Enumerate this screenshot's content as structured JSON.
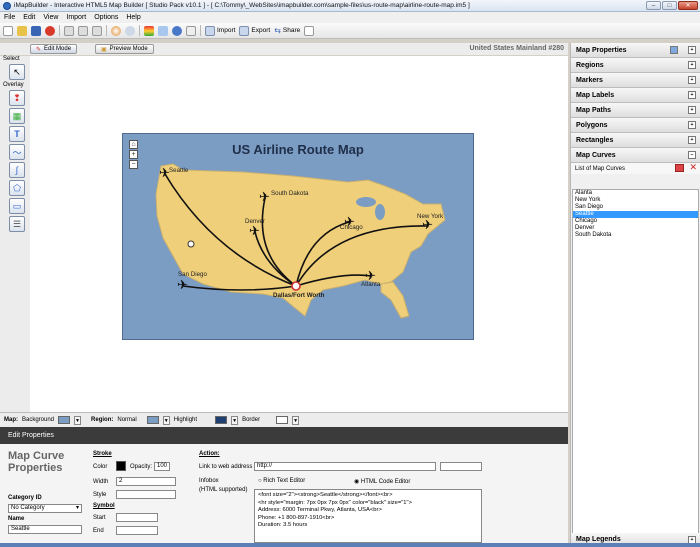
{
  "window": {
    "title": "iMapBuilder - Interactive HTML5 Map Builder [ Studio Pack v10.1 ] - [ C:\\Tommy\\_WebSites\\imapbuilder.com\\sample-files\\us-route-map\\airline-route-map.im5 ]",
    "min": "–",
    "max": "□",
    "close": "✕"
  },
  "menu": [
    "File",
    "Edit",
    "View",
    "Import",
    "Options",
    "Help"
  ],
  "toolbar": {
    "import": "Import",
    "export": "Export",
    "share": "Share"
  },
  "modes": {
    "edit": "Edit Mode",
    "preview": "Preview Mode"
  },
  "map_name": "United States Mainland #280",
  "tools": {
    "select_label": "Select",
    "overlay_label": "Overlay"
  },
  "map": {
    "title": "US Airline Route Map",
    "zoom_home": "⌂",
    "zoom_in": "+",
    "zoom_out": "−",
    "cities": {
      "seattle": "Seattle",
      "south_dakota": "South Dakota",
      "denver": "Denver",
      "chicago": "Chicago",
      "new_york": "New York",
      "san_diego": "San Diego",
      "atlanta": "Atlanta",
      "dallas": "Dallas/Fort Worth"
    }
  },
  "regionbar": {
    "map_label": "Map:",
    "background": "Background",
    "region_label": "Region:",
    "normal": "Normal",
    "highlight": "Highlight",
    "border": "Border",
    "colors": {
      "background": "#7b9cc3",
      "normal": "#7b9cc3",
      "highlight": "#1f3f73",
      "border": "#ffffff"
    }
  },
  "edit_properties": {
    "header": "Edit Properties",
    "section_title": "Map Curve Properties",
    "category_label": "Category ID",
    "category_value": "No Category",
    "name_label": "Name",
    "name_value": "Seattle",
    "stroke": "Stroke",
    "color": "Color",
    "opacity": "Opacity:",
    "opacity_value": "100",
    "width": "Width",
    "width_value": "2",
    "style": "Style",
    "symbol": "Symbol",
    "start": "Start",
    "end": "End",
    "action": "Action:",
    "link_label": "Link to web address",
    "link_value": "http://",
    "infobox": "Infobox",
    "html_supported": "(HTML supported)",
    "rich_text": "Rich Text Editor",
    "html_code": "HTML Code Editor",
    "info_lines": [
      "<font size=\"2\"><strong>Seattle</strong></font><br>",
      "<hr style=\"margin: 7px 0px 7px 0px\" color=\"black\" size=\"1\">",
      "Address: 6000 Terminal Pkwy, Atlanta, USA<br>",
      "Phone: +1 800-897-1910<br>",
      "Duration: 3.5 hours"
    ]
  },
  "right_panel": {
    "sections": [
      "Map Properties",
      "Regions",
      "Markers",
      "Map Labels",
      "Map Paths",
      "Polygons",
      "Rectangles",
      "Map Curves"
    ],
    "list_title": "List of Map Curves",
    "curves": [
      "Alanta",
      "New York",
      "San Diego",
      "Seattle",
      "Chicago",
      "Denver",
      "South Dakota"
    ],
    "selected": "Seattle",
    "legends": "Map Legends"
  }
}
